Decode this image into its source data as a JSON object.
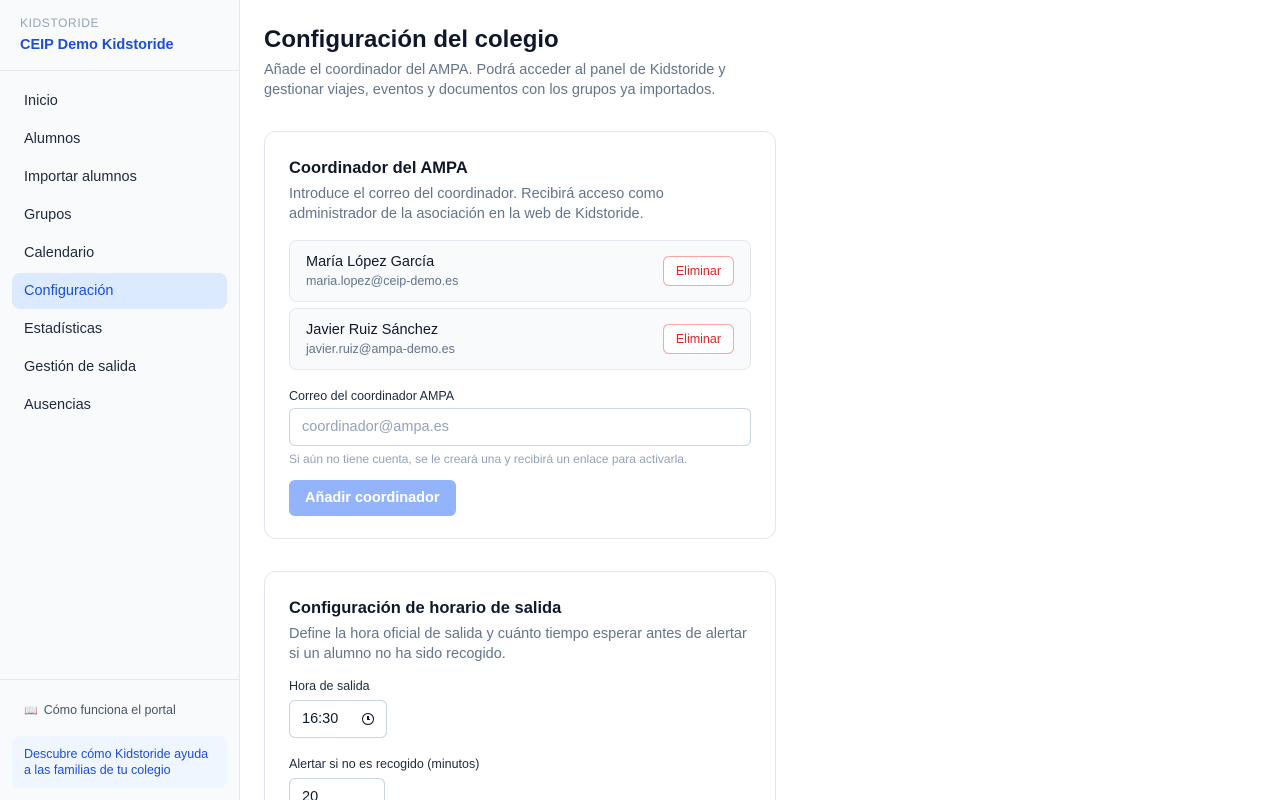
{
  "sidebar": {
    "eyebrow": "KIDSTORIDE",
    "school_name": "CEIP Demo Kidstoride",
    "items": [
      {
        "label": "Inicio"
      },
      {
        "label": "Alumnos"
      },
      {
        "label": "Importar alumnos"
      },
      {
        "label": "Grupos"
      },
      {
        "label": "Calendario"
      },
      {
        "label": "Configuración",
        "active": true
      },
      {
        "label": "Estadísticas"
      },
      {
        "label": "Gestión de salida"
      },
      {
        "label": "Ausencias"
      }
    ],
    "help_icon": "book-icon",
    "help_link": "Cómo funciona el portal",
    "promo_text": "Descubre cómo Kidstoride ayuda a las familias de tu colegio"
  },
  "page": {
    "title": "Configuración del colegio",
    "description": "Añade el coordinador del AMPA. Podrá acceder al panel de Kidstoride y gestionar viajes, eventos y documentos con los grupos ya importados."
  },
  "ampa": {
    "title": "Coordinador del AMPA",
    "description": "Introduce el correo del coordinador. Recibirá acceso como administrador de la asociación en la web de Kidstoride.",
    "coordinators": [
      {
        "name": "María López García",
        "email": "maria.lopez@ceip-demo.es",
        "remove_label": "Eliminar"
      },
      {
        "name": "Javier Ruiz Sánchez",
        "email": "javier.ruiz@ampa-demo.es",
        "remove_label": "Eliminar"
      }
    ],
    "email_label": "Correo del coordinador AMPA",
    "email_placeholder": "coordinador@ampa.es",
    "email_value": "",
    "hint": "Si aún no tiene cuenta, se le creará una y recibirá un enlace para activarla.",
    "add_label": "Añadir coordinador"
  },
  "schedule": {
    "title": "Configuración de horario de salida",
    "description": "Define la hora oficial de salida y cuánto tiempo esperar antes de alertar si un alumno no ha sido recogido.",
    "time_label": "Hora de salida",
    "time_value": "16:30",
    "time_icon": "clock-icon",
    "alert_label": "Alertar si no es recogido (minutos)",
    "alert_value": "20"
  },
  "colors": {
    "accent": "#1d4ed8",
    "active_bg": "#dbeafe",
    "danger": "#dc2626",
    "button_disabled": "#93b4fa"
  }
}
